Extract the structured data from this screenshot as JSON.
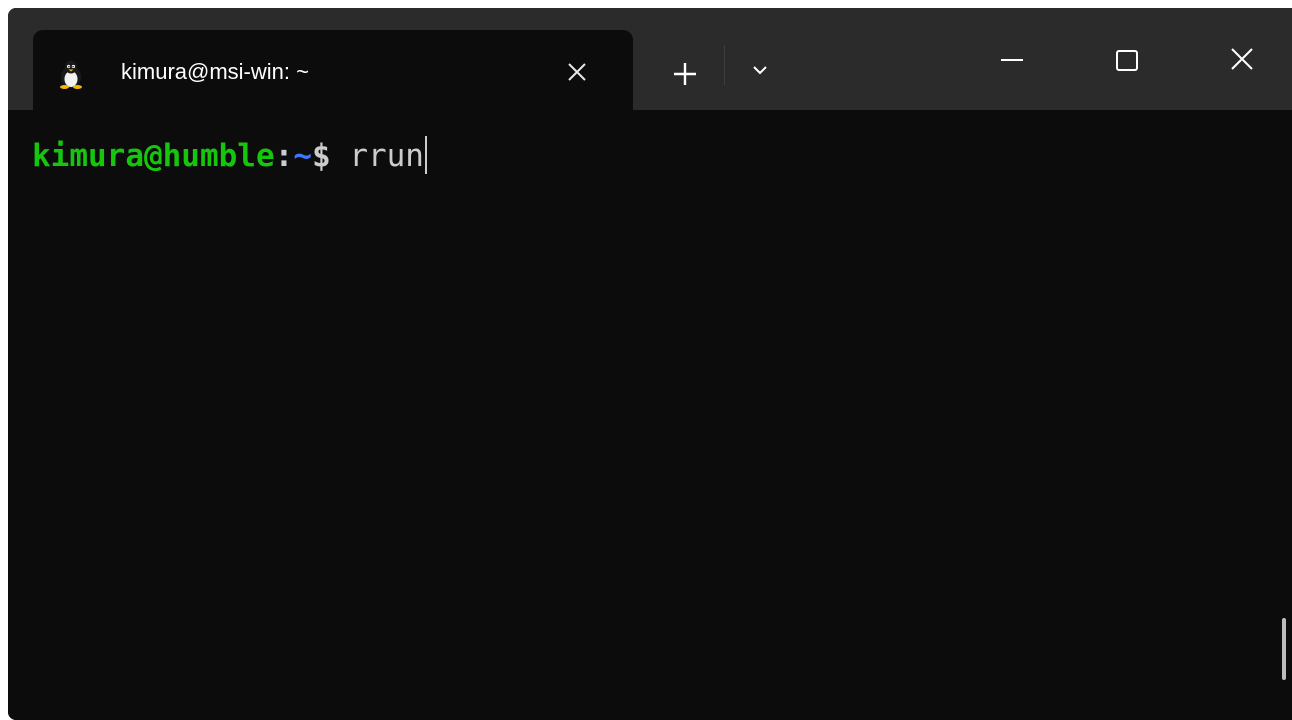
{
  "tab": {
    "title": "kimura@msi-win: ~",
    "icon": "linux-penguin-icon"
  },
  "titlebar_buttons": {
    "new_tab_icon": "plus-icon",
    "dropdown_icon": "chevron-down-icon",
    "minimize_icon": "minimize-icon",
    "maximize_icon": "maximize-icon",
    "close_icon": "close-icon"
  },
  "terminal": {
    "prompt_user": "kimura@humble",
    "prompt_colon": ":",
    "prompt_path": "~",
    "prompt_symbol": "$",
    "command": " rrun"
  },
  "colors": {
    "terminal_background": "#0c0c0c",
    "titlebar_background": "#2b2b2b",
    "prompt_user": "#16c60c",
    "prompt_path": "#3b78ff",
    "text": "#cccccc"
  }
}
